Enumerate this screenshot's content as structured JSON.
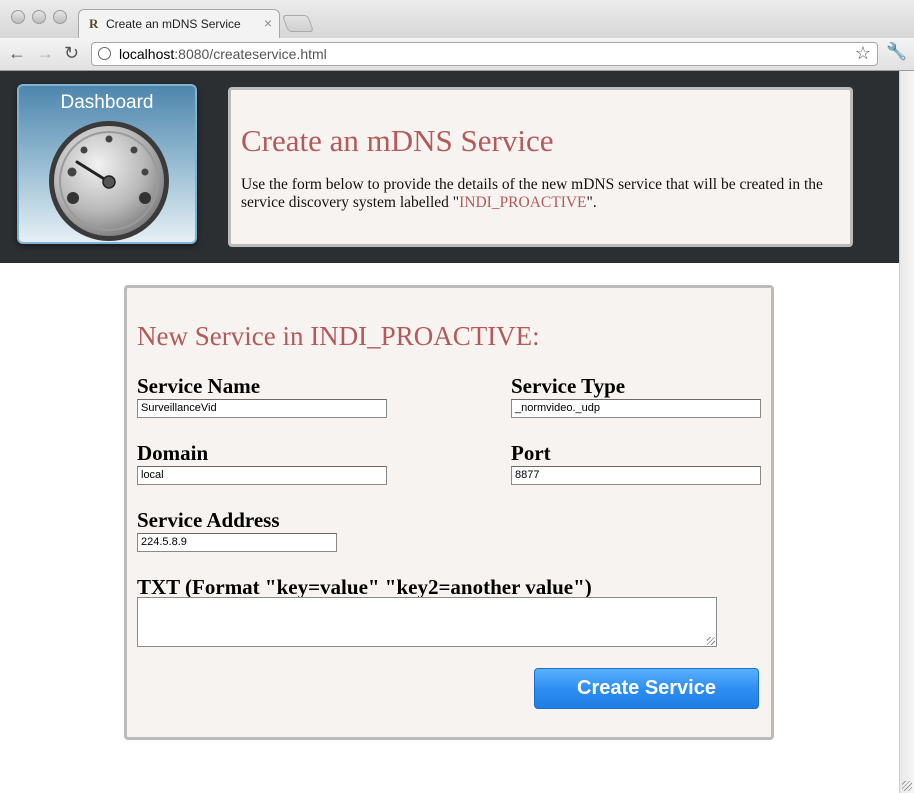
{
  "browser": {
    "tab_title": "Create an mDNS Service",
    "tab_favicon": "R",
    "tab_close_icon": "close-icon",
    "url_host": "localhost",
    "url_rest": ":8080/createservice.html"
  },
  "header": {
    "dashboard_label": "Dashboard",
    "title": "Create an mDNS Service",
    "description_before": "Use the form below to provide the details of the new mDNS service that will be created in the service discovery system labelled \"",
    "description_system": "INDI_PROACTIVE",
    "description_after": "\"."
  },
  "form": {
    "title": "New Service in INDI_PROACTIVE:",
    "service_name_label": "Service Name",
    "service_name_value": "SurveillanceVid",
    "service_type_label": "Service Type",
    "service_type_value": "_normvideo._udp",
    "domain_label": "Domain",
    "domain_value": "local",
    "port_label": "Port",
    "port_value": "8877",
    "address_label": "Service Address",
    "address_value": "224.5.8.9",
    "txt_label": "TXT (Format \"key=value\" \"key2=another value\")",
    "txt_value": "",
    "submit_label": "Create Service"
  },
  "colors": {
    "accent": "#b35a5a",
    "button": "#2f8ef0",
    "header_band": "#2b2f31",
    "card_bg": "#f7f3f0"
  }
}
